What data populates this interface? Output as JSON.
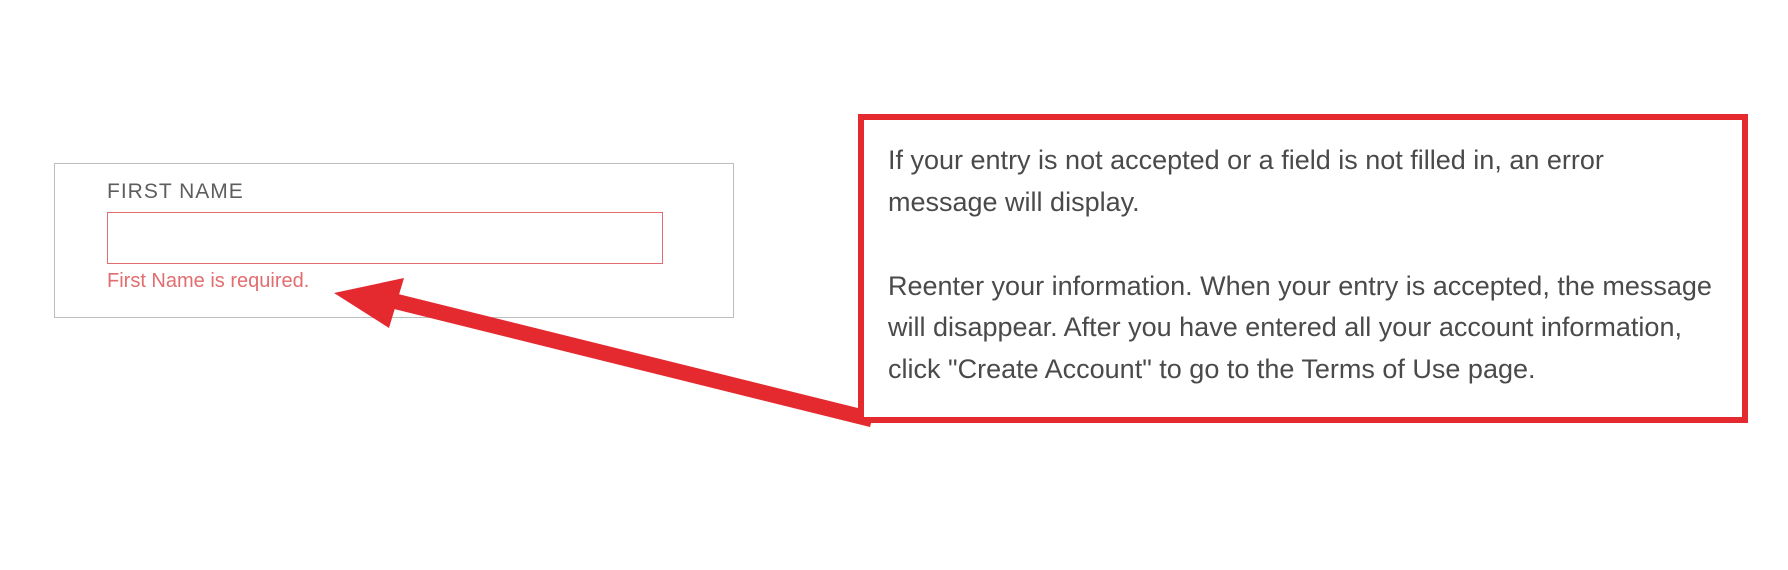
{
  "form": {
    "field_label": "FIRST NAME",
    "field_value": "",
    "field_placeholder": "",
    "error_message": "First Name is required."
  },
  "callout": {
    "text": "If your entry is not accepted or a field is not filled in, an error message will display.\n\nReenter your information. When your entry is accepted, the message will disappear. After you have entered all your account information, click \"Create Account\" to go to the Terms of Use page."
  },
  "colors": {
    "callout_border": "#e4292f",
    "error_text": "#e26d6f",
    "input_border_error": "#e26d6f"
  }
}
